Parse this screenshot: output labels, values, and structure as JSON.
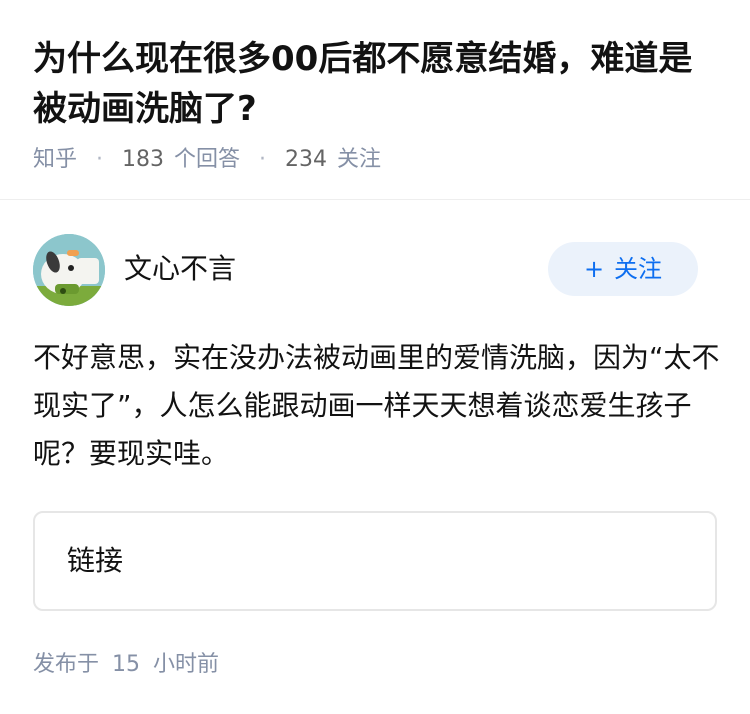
{
  "question": {
    "title": "为什么现在很多00后都不愿意结婚，难道是被动画洗脑了?",
    "source": "知乎",
    "answer_count": "183",
    "answer_label": "个回答",
    "follower_count": "234",
    "follower_label": "关注"
  },
  "answer": {
    "author": "文心不言",
    "follow_label": "关注",
    "follow_icon": "plus-icon",
    "content": "不好意思，实在没办法被动画里的爱情洗脑，因为“太不现实了”，人怎么能跟动画一样天天想着谈恋爱生孩子呢？要现实哇。",
    "link_label": "链接",
    "published_prefix": "发布于",
    "published_num": "15",
    "published_suffix": "小时前"
  },
  "colors": {
    "accent": "#0d6ef0",
    "follow_bg": "#ebf2fb",
    "meta_gray": "#8590a6"
  }
}
